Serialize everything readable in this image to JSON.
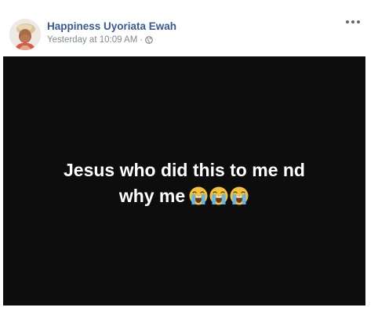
{
  "post": {
    "author_name": "Happiness Uyoriata Ewah",
    "timestamp": "Yesterday at 10:09 AM",
    "separator": "·",
    "privacy_icon": "globe-icon",
    "more_icon": "more-options-icon",
    "text_line_1": "Jesus who did this to me nd",
    "text_line_2": "why me",
    "emojis": [
      "crying-face-emoji",
      "crying-face-emoji",
      "crying-face-emoji"
    ],
    "background_color": "#0d0d0d",
    "text_color": "#ffffff",
    "author_color": "#385898"
  }
}
